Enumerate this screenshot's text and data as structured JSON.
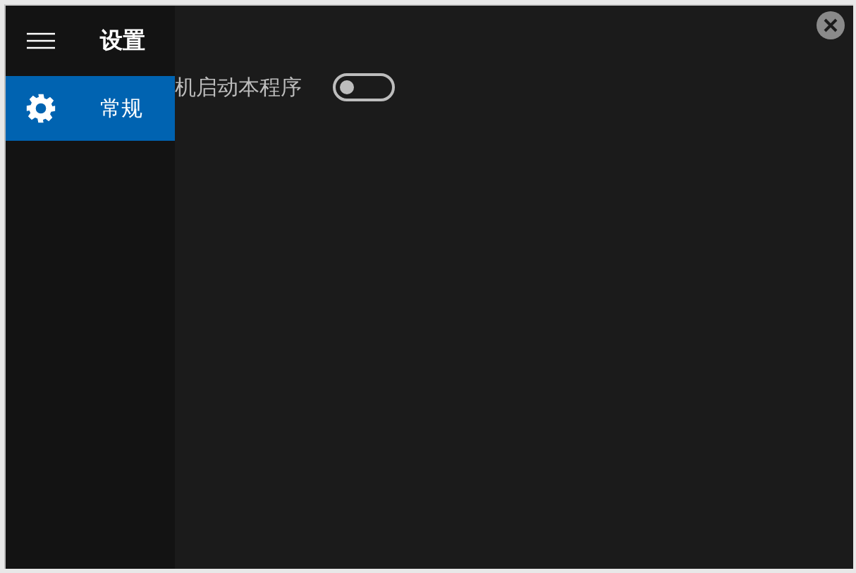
{
  "sidebar": {
    "title": "设置",
    "items": [
      {
        "label": "常规",
        "selected": true
      }
    ]
  },
  "settings": [
    {
      "label": "机启动本程序",
      "on": false
    }
  ]
}
